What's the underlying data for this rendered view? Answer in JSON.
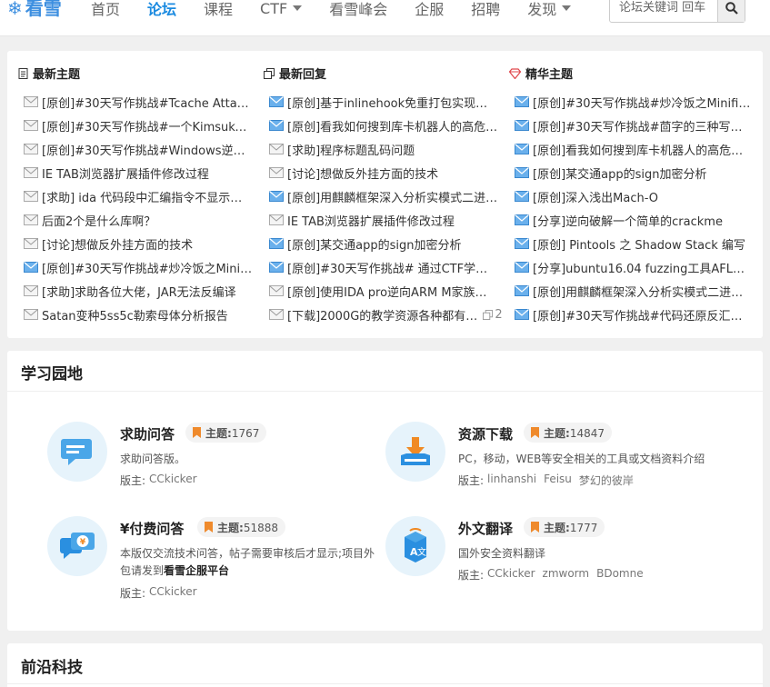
{
  "site": {
    "logo_glyph": "❄",
    "logo_text": "看雪"
  },
  "nav": [
    {
      "label": "首页",
      "active": false
    },
    {
      "label": "论坛",
      "active": true
    },
    {
      "label": "课程",
      "active": false
    },
    {
      "label": "CTF",
      "active": false,
      "dropdown": true
    },
    {
      "label": "看雪峰会",
      "active": false
    },
    {
      "label": "企服",
      "active": false
    },
    {
      "label": "招聘",
      "active": false
    },
    {
      "label": "发现",
      "active": false,
      "dropdown": true
    }
  ],
  "search": {
    "placeholder": "论坛关键词 回车"
  },
  "columns": [
    {
      "title": "最新主题",
      "icon": "document-icon",
      "threads": [
        "[原创]#30天写作挑战#Tcache Attack…",
        "[原创]#30天写作挑战#一个KimsukyA…",
        "[原创]#30天写作挑战#Windows逆向…",
        "IE TAB浏览器扩展插件修改过程",
        "[求助] ida 代码段中汇编指令不显示如…",
        "后面2个是什么库啊？",
        "[讨论]想做反外挂方面的技术",
        "[原创]#30天写作挑战#炒冷饭之Minifilt…",
        "[求助]求助各位大佬，JAR无法反编译",
        "Satan变种5ss5c勒索母体分析报告"
      ]
    },
    {
      "title": "最新回复",
      "icon": "copy-icon",
      "threads": [
        "[原创]基于inlinehook免重打包实现持…",
        "[原创]看我如何搜到库卡机器人的高危…",
        "[求助]程序标题乱码问题",
        "[讨论]想做反外挂方面的技术",
        "[原创]用麒麟框架深入分析实模式二进…",
        "IE TAB浏览器扩展插件修改过程",
        "[原创]某交通app的sign加密分析",
        "[原创]#30天写作挑战# 通过CTF学习A…",
        "[原创]使用IDA pro逆向ARM M家族心…",
        "[下载]2000G的教学资源各种都有…"
      ],
      "last_reply_count": "2"
    },
    {
      "title": "精华主题",
      "icon": "diamond-icon",
      "threads": [
        "[原创]#30天写作挑战#炒冷饭之Minifilter…",
        "[原创]#30天写作挑战#茴字的三种写法之…",
        "[原创]看我如何搜到库卡机器人的高危漏洞",
        "[原创]某交通app的sign加密分析",
        "[原创]深入浅出Mach-O",
        "[分享]逆向破解一个简单的crackme",
        "[原创] Pintools 之 Shadow Stack 编写",
        "[分享]ubuntu16.04 fuzzing工具AFL安装…",
        "[原创]用麒麟框架深入分析实模式二进制…",
        "[原创]#30天写作挑战#代码还原反汇编之…"
      ]
    }
  ],
  "study": {
    "title": "学习园地",
    "forums": [
      {
        "name": "求助问答",
        "topic_label": "主题:",
        "topics": "1767",
        "desc": "求助问答版。",
        "mods_label": "版主:",
        "mods": [
          "CCkicker"
        ]
      },
      {
        "name": "资源下载",
        "topic_label": "主题:",
        "topics": "14847",
        "desc": "PC，移动，WEB等安全相关的工具或文档资料介绍",
        "mods_label": "版主:",
        "mods": [
          "linhanshi",
          "Feisu",
          "梦幻的彼岸"
        ]
      },
      {
        "name": "¥付费问答",
        "topic_label": "主题:",
        "topics": "51888",
        "desc": "本版仅交流技术问答，帖子需要审核后才显示;项目外包请发到",
        "desc_bold": "看雪企服平台",
        "mods_label": "版主:",
        "mods": [
          "CCkicker"
        ]
      },
      {
        "name": "外文翻译",
        "topic_label": "主题:",
        "topics": "1777",
        "desc": "国外安全资料翻译",
        "mods_label": "版主:",
        "mods": [
          "CCkicker",
          "zmworm",
          "BDomne"
        ]
      }
    ]
  },
  "frontier": {
    "title": "前沿科技"
  },
  "colors": {
    "accent": "#1a8ae0",
    "bookmark": "#ef8a2c",
    "icon_bg": "#e6f3fb"
  }
}
